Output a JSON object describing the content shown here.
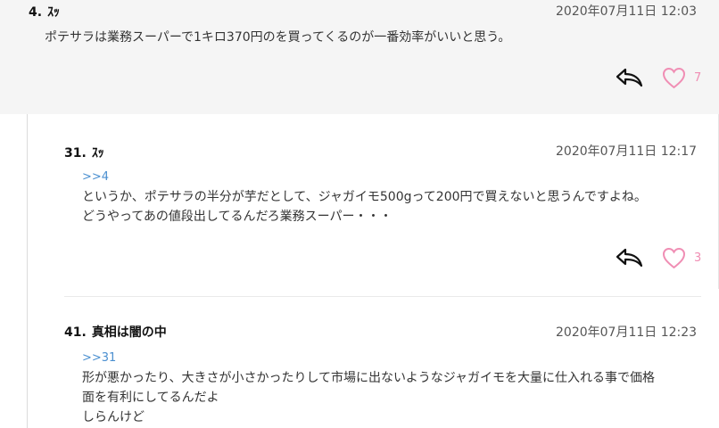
{
  "colors": {
    "heart": "#f08eb4",
    "anchor_link": "#4a8fd0",
    "top_comment_bg": "#f5f5f5"
  },
  "comments": [
    {
      "number": "4.",
      "name": "ｽｯ",
      "date": "2020年07月11日 12:03",
      "body": [
        "ポテサラは業務スーパーで1キロ370円のを買ってくるのが一番効率がいいと思う。"
      ],
      "likes": "7",
      "reply_icon": "reply-arrow-icon",
      "like_icon": "heart-outline-icon"
    },
    {
      "number": "31.",
      "name": "ｽｯ",
      "date": "2020年07月11日 12:17",
      "anchor": ">>4",
      "body": [
        "というか、ポテサラの半分が芋だとして、ジャガイモ500gって200円で買えないと思うんですよね。",
        "どうやってあの値段出してるんだろ業務スーパー・・・"
      ],
      "likes": "3",
      "reply_icon": "reply-arrow-icon",
      "like_icon": "heart-outline-icon"
    },
    {
      "number": "41.",
      "name": "真相は闇の中",
      "date": "2020年07月11日 12:23",
      "anchor": ">>31",
      "body": [
        "形が悪かったり、大きさが小さかったりして市場に出ないようなジャガイモを大量に仕入れる事で価格",
        "面を有利にしてるんだよ",
        "しらんけど"
      ]
    }
  ]
}
